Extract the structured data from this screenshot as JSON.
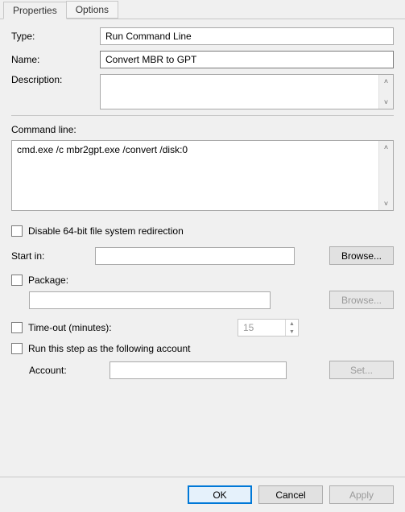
{
  "tabs": {
    "properties": "Properties",
    "options": "Options"
  },
  "fields": {
    "type_label": "Type:",
    "type_value": "Run Command Line",
    "name_label": "Name:",
    "name_value": "Convert MBR to GPT",
    "description_label": "Description:",
    "description_value": ""
  },
  "command": {
    "label": "Command line:",
    "value": "cmd.exe /c mbr2gpt.exe /convert /disk:0"
  },
  "options": {
    "disable64_label": "Disable 64-bit file system redirection",
    "startin_label": "Start in:",
    "startin_value": "",
    "browse_label": "Browse...",
    "package_label": "Package:",
    "package_value": "",
    "package_browse_label": "Browse...",
    "timeout_label": "Time-out (minutes):",
    "timeout_value": "15",
    "runas_label": "Run this step as the following account",
    "account_label": "Account:",
    "account_value": "",
    "set_label": "Set..."
  },
  "footer": {
    "ok": "OK",
    "cancel": "Cancel",
    "apply": "Apply"
  }
}
